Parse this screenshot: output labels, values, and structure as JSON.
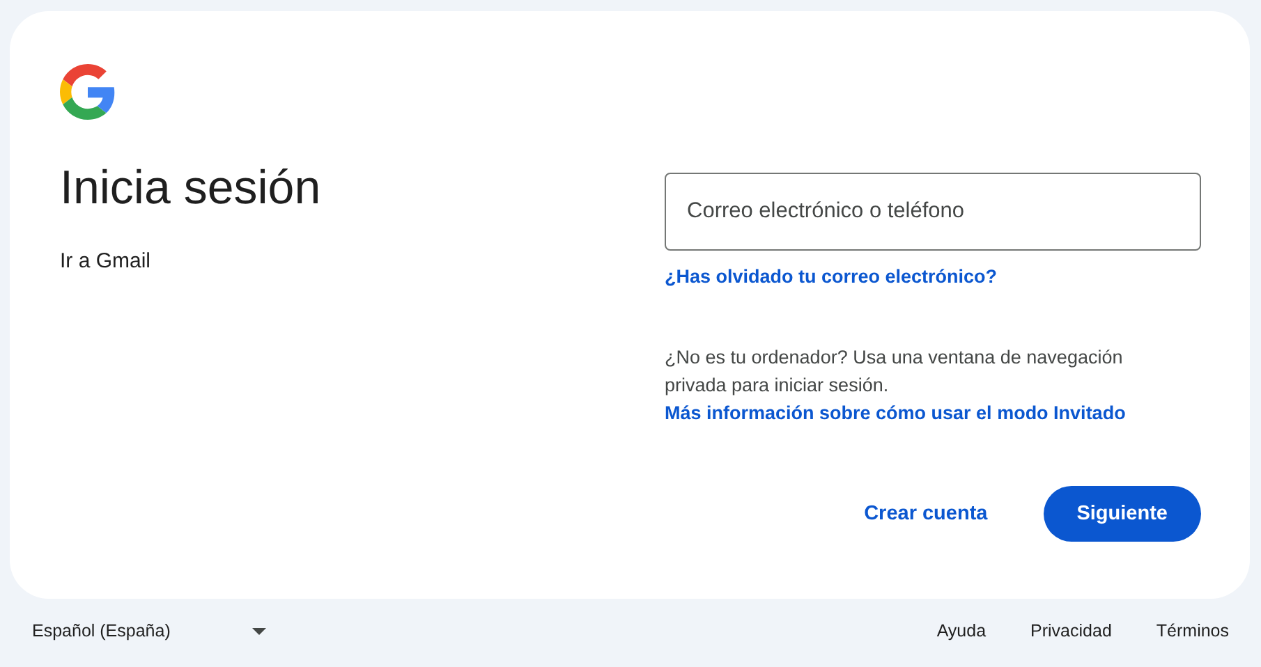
{
  "heading": "Inicia sesión",
  "subtitle": "Ir a Gmail",
  "email_field": {
    "placeholder": "Correo electrónico o teléfono"
  },
  "forgot_link": "¿Has olvidado tu correo electrónico?",
  "guest_notice": {
    "text": "¿No es tu ordenador? Usa una ventana de navegación privada para iniciar sesión.",
    "link": "Más información sobre cómo usar el modo Invitado"
  },
  "buttons": [
    {
      "label": "Crear cuenta",
      "kind": "text"
    },
    {
      "label": "Siguiente",
      "kind": "filled"
    }
  ],
  "footer": {
    "language": "Español (España)",
    "links": [
      "Ayuda",
      "Privacidad",
      "Términos"
    ]
  }
}
